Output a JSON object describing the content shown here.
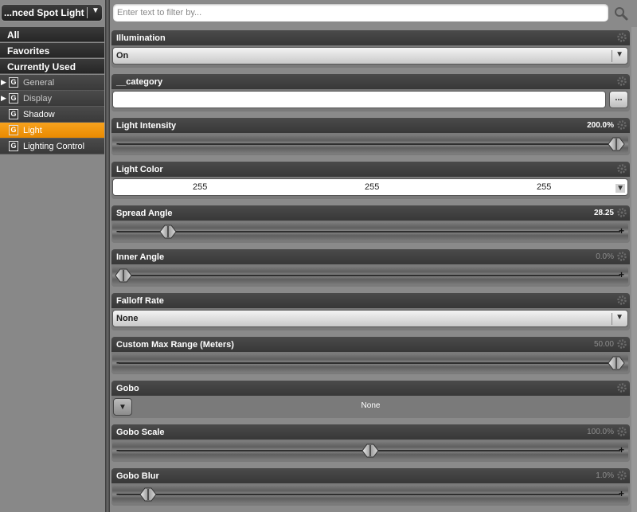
{
  "node_selector": {
    "label": "...nced Spot Light",
    "arrow": "▼"
  },
  "filters": {
    "all": "All",
    "favorites": "Favorites",
    "currently_used": "Currently Used"
  },
  "groups": [
    {
      "letter": "G",
      "label": "General",
      "expandable": true,
      "active": false
    },
    {
      "letter": "G",
      "label": "Display",
      "expandable": true,
      "active": false
    },
    {
      "letter": "G",
      "label": "Shadow",
      "expandable": false,
      "active": false
    },
    {
      "letter": "G",
      "label": "Light",
      "expandable": false,
      "active": true
    },
    {
      "letter": "G",
      "label": "Lighting Control",
      "expandable": false,
      "active": false
    }
  ],
  "search": {
    "placeholder": "Enter text to filter by..."
  },
  "properties": {
    "illumination": {
      "label": "Illumination",
      "value": "On"
    },
    "category": {
      "label": "__category",
      "value": "",
      "browse_label": "..."
    },
    "light_intensity": {
      "label": "Light Intensity",
      "value": "200.0%",
      "level": 1.0
    },
    "light_color": {
      "label": "Light Color",
      "r": "255",
      "g": "255",
      "b": "255"
    },
    "spread_angle": {
      "label": "Spread Angle",
      "value": "28.25",
      "level": 0.09
    },
    "inner_angle": {
      "label": "Inner Angle",
      "value": "0.0%",
      "level": 0.0
    },
    "falloff_rate": {
      "label": "Falloff Rate",
      "value": "None"
    },
    "custom_max_range": {
      "label": "Custom Max Range (Meters)",
      "value": "50.00",
      "level": 1.0
    },
    "gobo": {
      "label": "Gobo",
      "value": "None"
    },
    "gobo_scale": {
      "label": "Gobo Scale",
      "value": "100.0%",
      "level": 0.5
    },
    "gobo_blur": {
      "label": "Gobo Blur",
      "value": "1.0%",
      "level": 0.05
    }
  },
  "slider_symbols": {
    "minus": "-",
    "plus": "+"
  },
  "colors": {
    "accent": "#f39a12",
    "header": "#404040",
    "panel": "#888888"
  }
}
